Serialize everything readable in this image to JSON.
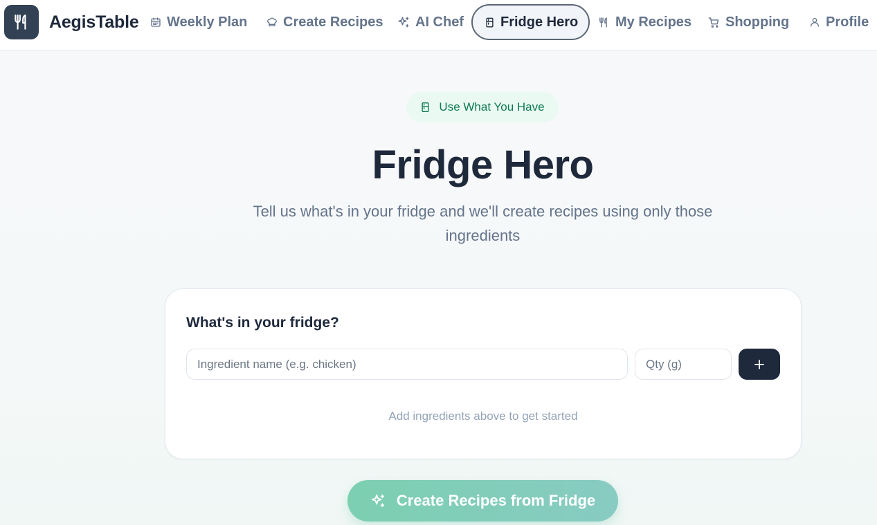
{
  "brand": {
    "name": "AegisTable",
    "logo_icon": "fork-knife-icon",
    "logo_bg": "#334155"
  },
  "nav": {
    "items": [
      {
        "label": "Weekly Plan",
        "icon": "calendar-icon",
        "active": false
      },
      {
        "label": "Create Recipes",
        "icon": "chef-hat-icon",
        "active": false
      },
      {
        "label": "AI Chef",
        "icon": "sparkles-icon",
        "active": false
      },
      {
        "label": "Fridge Hero",
        "icon": "fridge-icon",
        "active": true
      },
      {
        "label": "My Recipes",
        "icon": "fork-knife-icon",
        "active": false
      },
      {
        "label": "Shopping",
        "icon": "cart-icon",
        "active": false
      },
      {
        "label": "Profile",
        "icon": "user-icon",
        "active": false
      }
    ]
  },
  "hero": {
    "badge": "Use What You Have",
    "badge_icon": "fridge-icon",
    "title": "Fridge Hero",
    "subtitle": "Tell us what's in your fridge and we'll create recipes using only those ingredients"
  },
  "fridge_form": {
    "heading": "What's in your fridge?",
    "ingredient_placeholder": "Ingredient name (e.g. chicken)",
    "ingredient_value": "",
    "qty_placeholder": "Qty (g)",
    "qty_value": "",
    "add_button_icon": "plus-icon",
    "empty_hint": "Add ingredients above to get started"
  },
  "cta": {
    "label": "Create Recipes from Fridge",
    "icon": "sparkles-icon"
  },
  "colors": {
    "accent_green": "#0f7a55",
    "badge_bg": "#eafaf3",
    "dark": "#1e293b",
    "muted": "#64748b",
    "cta_gradient_start": "#7ccfb1",
    "cta_gradient_end": "#88cbc2"
  }
}
